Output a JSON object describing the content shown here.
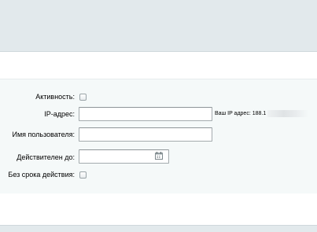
{
  "form": {
    "active_label": "Активность:",
    "ip_label": "IP-адрес:",
    "ip_value": "",
    "your_ip_text": "Ваш IP адрес: 188.1",
    "username_label": "Имя пользователя:",
    "username_value": "",
    "valid_until_label": "Действителен до:",
    "valid_until_value": "",
    "no_expiry_label": "Без срока действия:"
  },
  "checkboxes": {
    "active_checked": false,
    "no_expiry_checked": false
  },
  "colors": {
    "header_band": "#e2e9ec",
    "form_background": "#f5f9f9",
    "input_border": "#a4abae"
  },
  "icons": {
    "calendar": "calendar-icon"
  }
}
